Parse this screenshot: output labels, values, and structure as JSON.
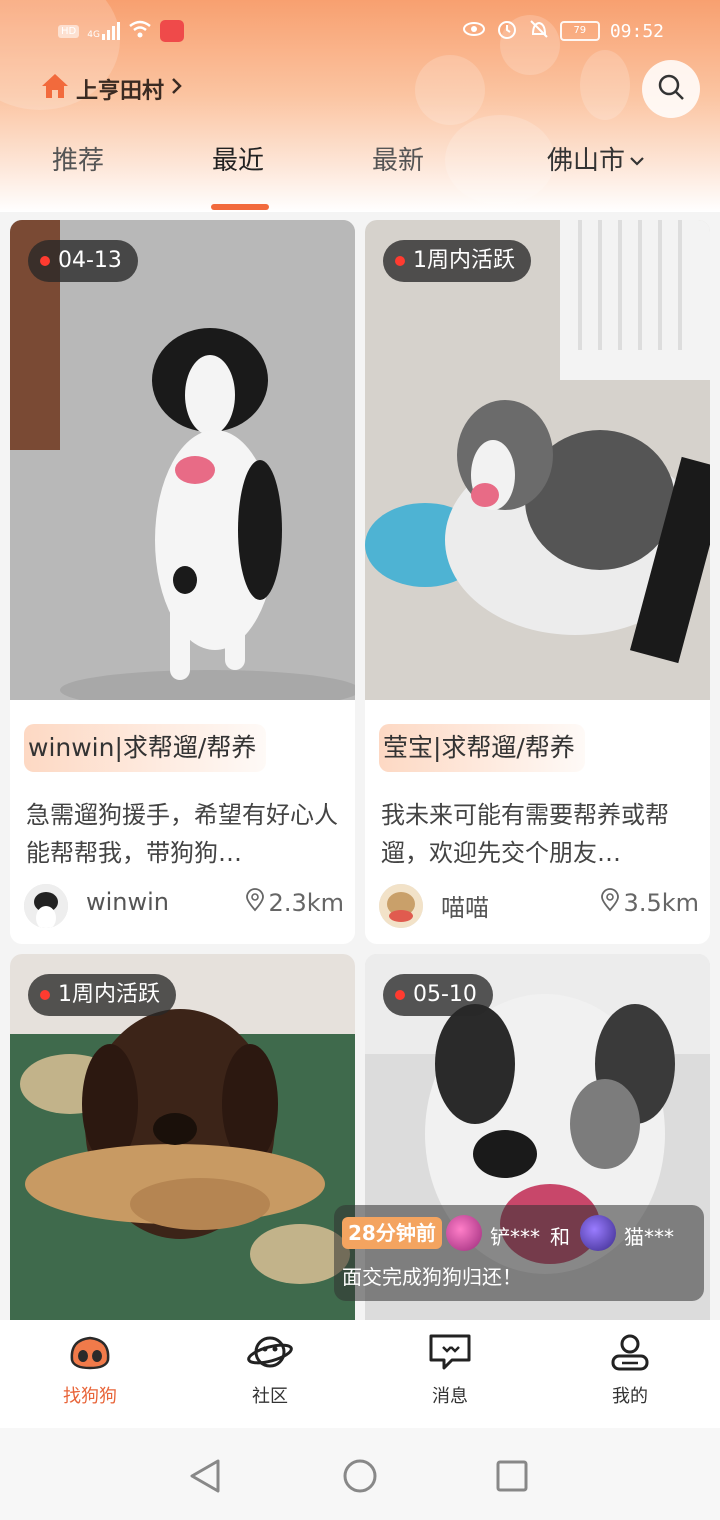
{
  "status_bar": {
    "time": "09:52",
    "battery": "79",
    "signal": "4G",
    "hd": "HD"
  },
  "header": {
    "location": "上亨田村"
  },
  "tabs": [
    {
      "label": "推荐",
      "active": false
    },
    {
      "label": "最近",
      "active": true
    },
    {
      "label": "最新",
      "active": false
    }
  ],
  "city": "佛山市",
  "cards": [
    {
      "tag": "04-13",
      "title": "winwin|求帮遛/帮养",
      "desc": "急需遛狗援手，希望有好心人能帮帮我，带狗狗…",
      "author": "winwin",
      "distance": "2.3km"
    },
    {
      "tag": "1周内活跃",
      "title": "莹宝|求帮遛/帮养",
      "desc": "我未来可能有需要帮养或帮遛，欢迎先交个朋友…",
      "author": "喵喵",
      "distance": "3.5km"
    },
    {
      "tag": "1周内活跃"
    },
    {
      "tag": "05-10"
    }
  ],
  "toast": {
    "time": "28分钟前",
    "user1": "铲***",
    "conj": "和",
    "user2": "猫***",
    "message": "面交完成狗狗归还！"
  },
  "bottom_nav": [
    {
      "label": "找狗狗",
      "icon": "dog-nose-icon",
      "active": true
    },
    {
      "label": "社区",
      "icon": "planet-icon",
      "active": false
    },
    {
      "label": "消息",
      "icon": "chat-icon",
      "active": false
    },
    {
      "label": "我的",
      "icon": "profile-icon",
      "active": false
    }
  ],
  "colors": {
    "accent": "#f26a3c",
    "active_nav": "#e8653a"
  }
}
